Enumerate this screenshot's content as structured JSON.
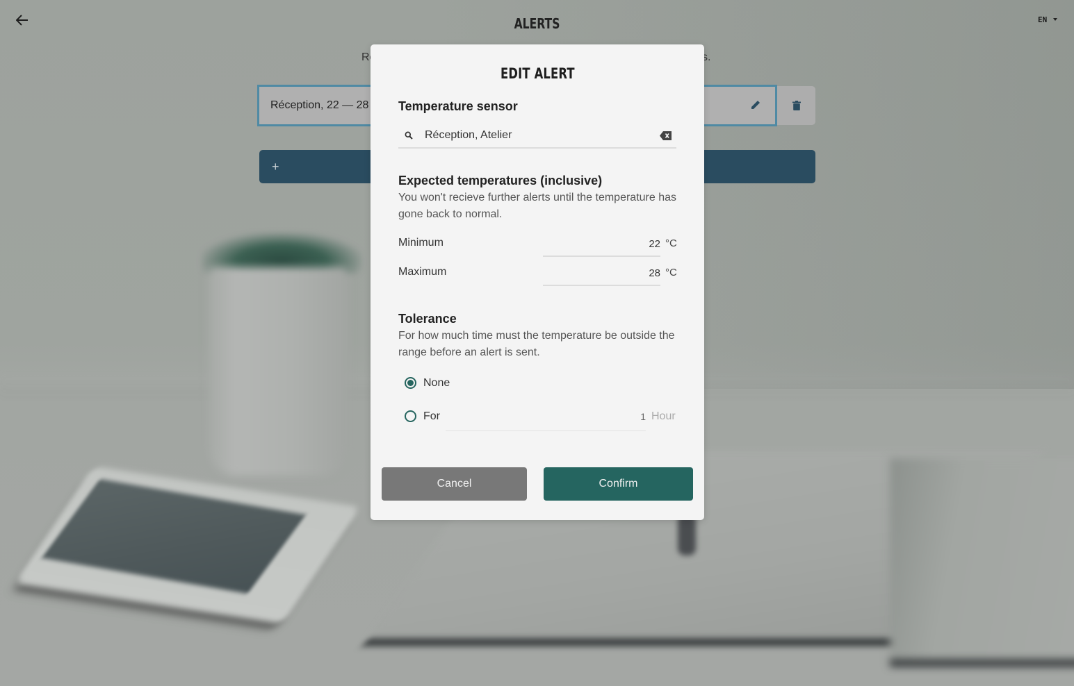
{
  "page": {
    "title": "ALERTS",
    "subtitle_visible_start": "Re",
    "subtitle_visible_end": "s.",
    "language": "EN",
    "alerts": [
      {
        "label": "Réception, 22 — 28"
      }
    ],
    "add_alert_icon": "+"
  },
  "modal": {
    "title": "EDIT ALERT",
    "sensor": {
      "heading": "Temperature sensor",
      "value": "Réception, Atelier",
      "search_icon": "search-icon",
      "clear_icon": "backspace-clear-icon"
    },
    "expected": {
      "heading": "Expected temperatures (inclusive)",
      "description": "You won't recieve further alerts until the temperature has gone back to normal.",
      "minimum_label": "Minimum",
      "minimum_value": "22",
      "maximum_label": "Maximum",
      "maximum_value": "28",
      "unit": "°C"
    },
    "tolerance": {
      "heading": "Tolerance",
      "description": "For how much time must the temperature be outside the range before an alert is sent.",
      "options": [
        {
          "label": "None",
          "selected": true
        },
        {
          "label": "For",
          "selected": false
        }
      ],
      "duration_value": "1",
      "duration_unit": "Hour"
    },
    "buttons": {
      "cancel": "Cancel",
      "confirm": "Confirm"
    }
  },
  "colors": {
    "primary_teal": "#256560",
    "cancel_gray": "#787878",
    "add_button_blue": "#2a4c60",
    "selected_border": "#4f8aa4"
  }
}
